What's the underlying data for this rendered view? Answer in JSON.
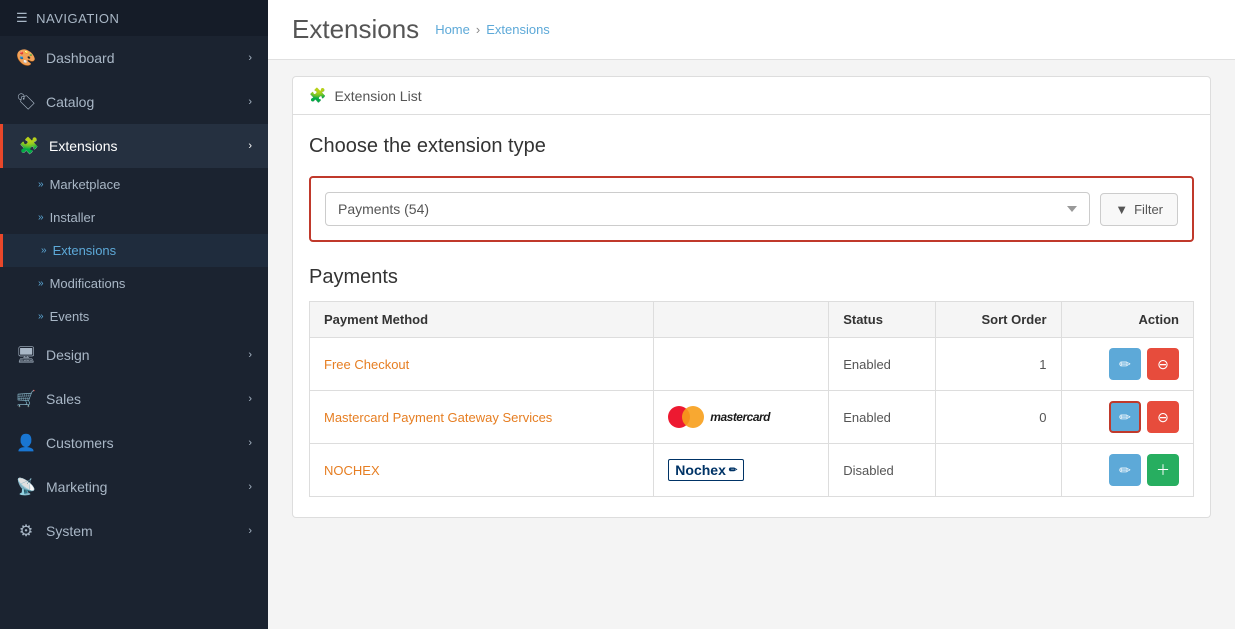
{
  "nav": {
    "header": "NAVIGATION"
  },
  "sidebar": {
    "items": [
      {
        "id": "dashboard",
        "icon": "🎨",
        "label": "Dashboard",
        "has_arrow": true,
        "active": false
      },
      {
        "id": "catalog",
        "icon": "🏷",
        "label": "Catalog",
        "has_arrow": true,
        "active": false
      },
      {
        "id": "extensions",
        "icon": "🧩",
        "label": "Extensions",
        "has_arrow": true,
        "active": true
      }
    ],
    "extensions_sub": [
      {
        "id": "marketplace",
        "label": "Marketplace",
        "active": false
      },
      {
        "id": "installer",
        "label": "Installer",
        "active": false
      },
      {
        "id": "extensions-sub",
        "label": "Extensions",
        "active": true
      }
    ],
    "extensions_sub2": [
      {
        "id": "modifications",
        "label": "Modifications",
        "active": false
      },
      {
        "id": "events",
        "label": "Events",
        "active": false
      }
    ],
    "bottom_items": [
      {
        "id": "design",
        "icon": "🖥",
        "label": "Design",
        "has_arrow": true
      },
      {
        "id": "sales",
        "icon": "🛒",
        "label": "Sales",
        "has_arrow": true
      },
      {
        "id": "customers",
        "icon": "👤",
        "label": "Customers",
        "has_arrow": true
      },
      {
        "id": "marketing",
        "icon": "📡",
        "label": "Marketing",
        "has_arrow": true
      },
      {
        "id": "system",
        "icon": "⚙",
        "label": "System",
        "has_arrow": true
      }
    ]
  },
  "header": {
    "title": "Extensions",
    "breadcrumb_home": "Home",
    "breadcrumb_sep": "›",
    "breadcrumb_current": "Extensions"
  },
  "section": {
    "header_icon": "🧩",
    "header_label": "Extension List",
    "choose_title": "Choose the extension type",
    "filter_value": "Payments (54)",
    "filter_btn": "Filter",
    "payments_title": "Payments"
  },
  "table": {
    "col_payment_method": "Payment Method",
    "col_status": "Status",
    "col_sort_order": "Sort Order",
    "col_action": "Action",
    "rows": [
      {
        "id": "free-checkout",
        "name": "Free Checkout",
        "logo": "none",
        "status": "Enabled",
        "status_class": "enabled",
        "sort_order": "1",
        "has_delete": true,
        "edit_highlighted": false
      },
      {
        "id": "mastercard",
        "name": "Mastercard Payment Gateway Services",
        "logo": "mastercard",
        "status": "Enabled",
        "status_class": "enabled",
        "sort_order": "0",
        "has_delete": true,
        "edit_highlighted": true
      },
      {
        "id": "nochex",
        "name": "NOCHEX",
        "logo": "nochex",
        "status": "Disabled",
        "status_class": "disabled",
        "sort_order": "",
        "has_delete": false,
        "edit_highlighted": false
      }
    ]
  }
}
